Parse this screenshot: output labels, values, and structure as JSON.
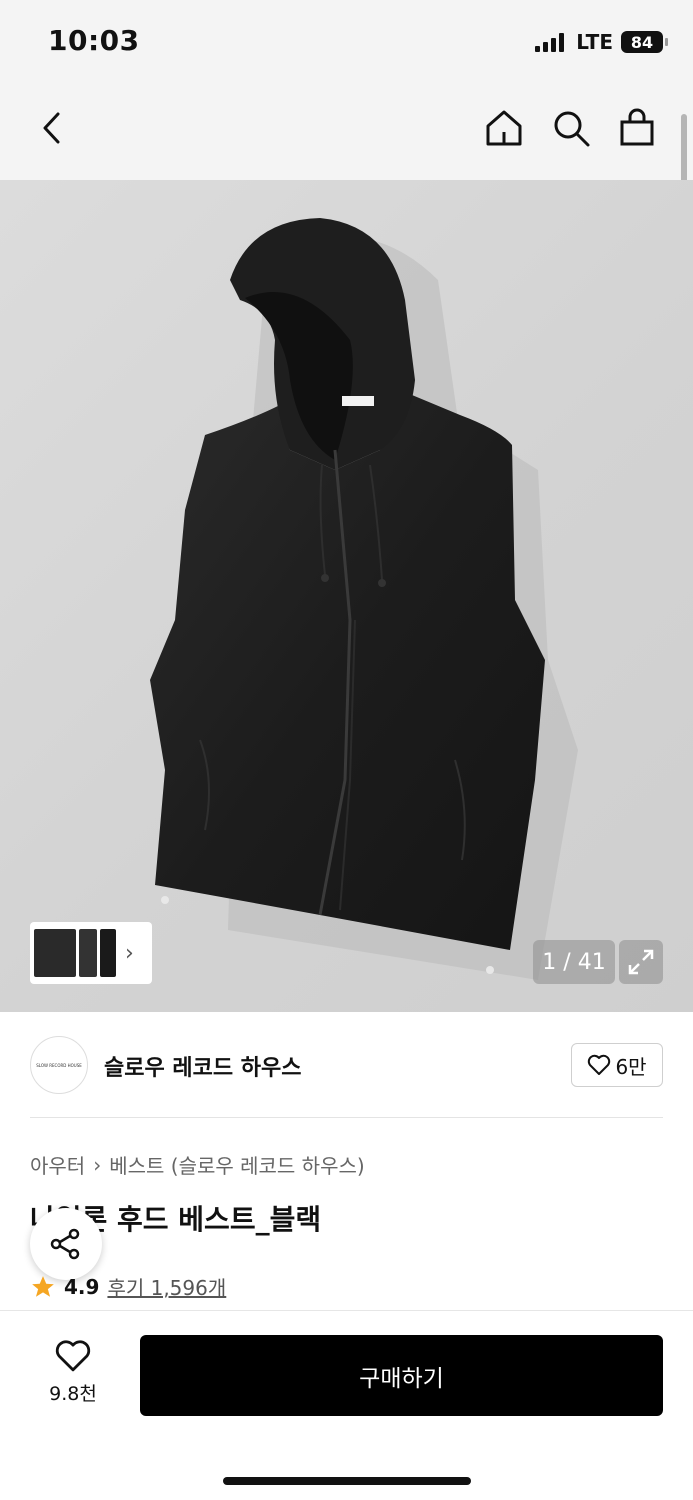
{
  "status_bar": {
    "time": "10:03",
    "network": "LTE",
    "battery": "84"
  },
  "product": {
    "page_counter": "1 / 41",
    "brand_name": "슬로우 레코드 하우스",
    "brand_logo_text": "SLOW RECORD HOUSE",
    "brand_likes": "6만",
    "breadcrumb": [
      "아우터",
      "베스트 (슬로우 레코드 하우스)"
    ],
    "title": "나일론 후드 베스트_블랙",
    "rating": "4.9",
    "reviews": "후기 1,596개"
  },
  "bottom_bar": {
    "wish_count": "9.8천",
    "buy_label": "구매하기"
  },
  "colors": {
    "accent_star": "#f5a623",
    "buy_button": "#000000"
  },
  "icons": [
    "back-icon",
    "home-icon",
    "search-icon",
    "bag-icon",
    "expand-icon",
    "heart-icon",
    "share-icon",
    "star-icon",
    "chevron-right-icon"
  ]
}
